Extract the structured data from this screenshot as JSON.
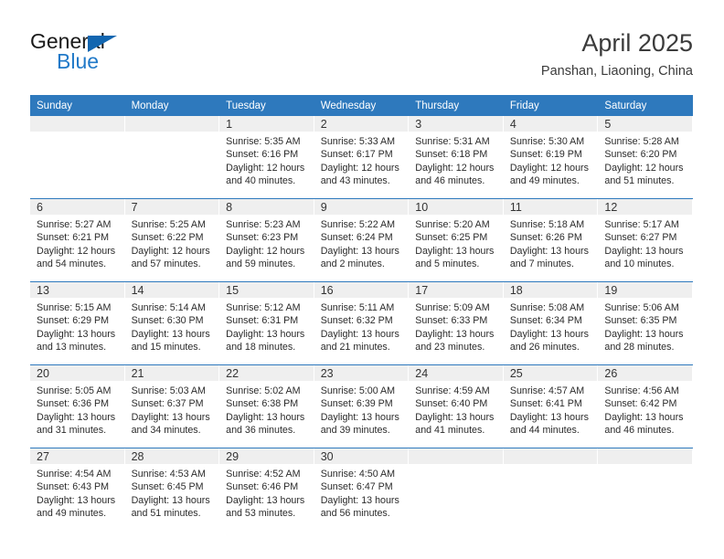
{
  "brand": {
    "name_dark": "General",
    "name_blue": "Blue",
    "accent_color": "#1266b0",
    "blue_text_color": "#2079c8"
  },
  "header": {
    "title": "April 2025",
    "subtitle": "Panshan, Liaoning, China"
  },
  "calendar": {
    "header_bg": "#2e79bd",
    "date_band_bg": "#efefef",
    "weekday_headers": [
      "Sunday",
      "Monday",
      "Tuesday",
      "Wednesday",
      "Thursday",
      "Friday",
      "Saturday"
    ],
    "weeks": [
      [
        {
          "date": "",
          "lines": []
        },
        {
          "date": "",
          "lines": []
        },
        {
          "date": "1",
          "lines": [
            "Sunrise: 5:35 AM",
            "Sunset: 6:16 PM",
            "Daylight: 12 hours",
            "and 40 minutes."
          ]
        },
        {
          "date": "2",
          "lines": [
            "Sunrise: 5:33 AM",
            "Sunset: 6:17 PM",
            "Daylight: 12 hours",
            "and 43 minutes."
          ]
        },
        {
          "date": "3",
          "lines": [
            "Sunrise: 5:31 AM",
            "Sunset: 6:18 PM",
            "Daylight: 12 hours",
            "and 46 minutes."
          ]
        },
        {
          "date": "4",
          "lines": [
            "Sunrise: 5:30 AM",
            "Sunset: 6:19 PM",
            "Daylight: 12 hours",
            "and 49 minutes."
          ]
        },
        {
          "date": "5",
          "lines": [
            "Sunrise: 5:28 AM",
            "Sunset: 6:20 PM",
            "Daylight: 12 hours",
            "and 51 minutes."
          ]
        }
      ],
      [
        {
          "date": "6",
          "lines": [
            "Sunrise: 5:27 AM",
            "Sunset: 6:21 PM",
            "Daylight: 12 hours",
            "and 54 minutes."
          ]
        },
        {
          "date": "7",
          "lines": [
            "Sunrise: 5:25 AM",
            "Sunset: 6:22 PM",
            "Daylight: 12 hours",
            "and 57 minutes."
          ]
        },
        {
          "date": "8",
          "lines": [
            "Sunrise: 5:23 AM",
            "Sunset: 6:23 PM",
            "Daylight: 12 hours",
            "and 59 minutes."
          ]
        },
        {
          "date": "9",
          "lines": [
            "Sunrise: 5:22 AM",
            "Sunset: 6:24 PM",
            "Daylight: 13 hours",
            "and 2 minutes."
          ]
        },
        {
          "date": "10",
          "lines": [
            "Sunrise: 5:20 AM",
            "Sunset: 6:25 PM",
            "Daylight: 13 hours",
            "and 5 minutes."
          ]
        },
        {
          "date": "11",
          "lines": [
            "Sunrise: 5:18 AM",
            "Sunset: 6:26 PM",
            "Daylight: 13 hours",
            "and 7 minutes."
          ]
        },
        {
          "date": "12",
          "lines": [
            "Sunrise: 5:17 AM",
            "Sunset: 6:27 PM",
            "Daylight: 13 hours",
            "and 10 minutes."
          ]
        }
      ],
      [
        {
          "date": "13",
          "lines": [
            "Sunrise: 5:15 AM",
            "Sunset: 6:29 PM",
            "Daylight: 13 hours",
            "and 13 minutes."
          ]
        },
        {
          "date": "14",
          "lines": [
            "Sunrise: 5:14 AM",
            "Sunset: 6:30 PM",
            "Daylight: 13 hours",
            "and 15 minutes."
          ]
        },
        {
          "date": "15",
          "lines": [
            "Sunrise: 5:12 AM",
            "Sunset: 6:31 PM",
            "Daylight: 13 hours",
            "and 18 minutes."
          ]
        },
        {
          "date": "16",
          "lines": [
            "Sunrise: 5:11 AM",
            "Sunset: 6:32 PM",
            "Daylight: 13 hours",
            "and 21 minutes."
          ]
        },
        {
          "date": "17",
          "lines": [
            "Sunrise: 5:09 AM",
            "Sunset: 6:33 PM",
            "Daylight: 13 hours",
            "and 23 minutes."
          ]
        },
        {
          "date": "18",
          "lines": [
            "Sunrise: 5:08 AM",
            "Sunset: 6:34 PM",
            "Daylight: 13 hours",
            "and 26 minutes."
          ]
        },
        {
          "date": "19",
          "lines": [
            "Sunrise: 5:06 AM",
            "Sunset: 6:35 PM",
            "Daylight: 13 hours",
            "and 28 minutes."
          ]
        }
      ],
      [
        {
          "date": "20",
          "lines": [
            "Sunrise: 5:05 AM",
            "Sunset: 6:36 PM",
            "Daylight: 13 hours",
            "and 31 minutes."
          ]
        },
        {
          "date": "21",
          "lines": [
            "Sunrise: 5:03 AM",
            "Sunset: 6:37 PM",
            "Daylight: 13 hours",
            "and 34 minutes."
          ]
        },
        {
          "date": "22",
          "lines": [
            "Sunrise: 5:02 AM",
            "Sunset: 6:38 PM",
            "Daylight: 13 hours",
            "and 36 minutes."
          ]
        },
        {
          "date": "23",
          "lines": [
            "Sunrise: 5:00 AM",
            "Sunset: 6:39 PM",
            "Daylight: 13 hours",
            "and 39 minutes."
          ]
        },
        {
          "date": "24",
          "lines": [
            "Sunrise: 4:59 AM",
            "Sunset: 6:40 PM",
            "Daylight: 13 hours",
            "and 41 minutes."
          ]
        },
        {
          "date": "25",
          "lines": [
            "Sunrise: 4:57 AM",
            "Sunset: 6:41 PM",
            "Daylight: 13 hours",
            "and 44 minutes."
          ]
        },
        {
          "date": "26",
          "lines": [
            "Sunrise: 4:56 AM",
            "Sunset: 6:42 PM",
            "Daylight: 13 hours",
            "and 46 minutes."
          ]
        }
      ],
      [
        {
          "date": "27",
          "lines": [
            "Sunrise: 4:54 AM",
            "Sunset: 6:43 PM",
            "Daylight: 13 hours",
            "and 49 minutes."
          ]
        },
        {
          "date": "28",
          "lines": [
            "Sunrise: 4:53 AM",
            "Sunset: 6:45 PM",
            "Daylight: 13 hours",
            "and 51 minutes."
          ]
        },
        {
          "date": "29",
          "lines": [
            "Sunrise: 4:52 AM",
            "Sunset: 6:46 PM",
            "Daylight: 13 hours",
            "and 53 minutes."
          ]
        },
        {
          "date": "30",
          "lines": [
            "Sunrise: 4:50 AM",
            "Sunset: 6:47 PM",
            "Daylight: 13 hours",
            "and 56 minutes."
          ]
        },
        {
          "date": "",
          "lines": []
        },
        {
          "date": "",
          "lines": []
        },
        {
          "date": "",
          "lines": []
        }
      ]
    ]
  }
}
